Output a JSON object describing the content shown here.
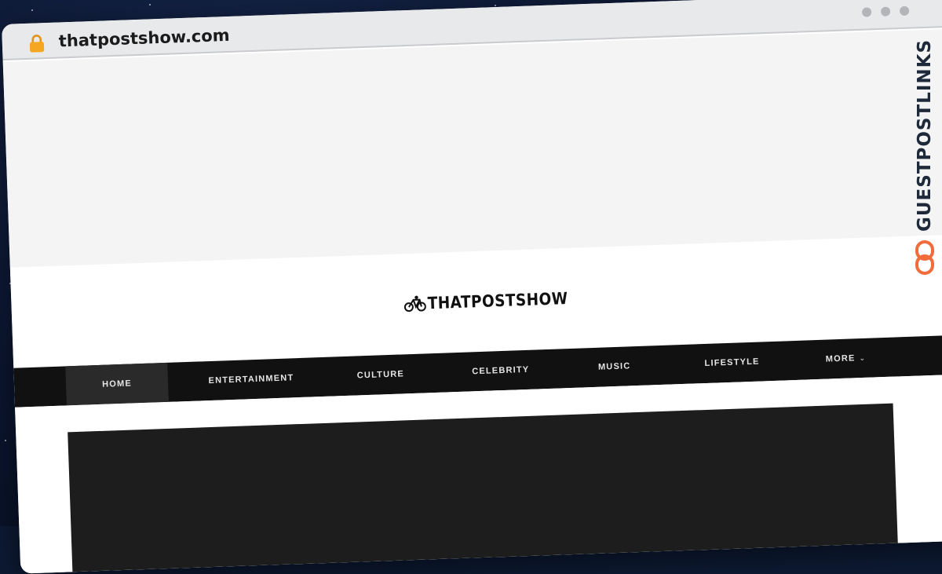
{
  "browser": {
    "url": "thatpostshow.com",
    "icons": {
      "lock": "lock-icon",
      "window_controls": [
        "dot-icon",
        "dot-icon",
        "dot-icon"
      ]
    }
  },
  "site": {
    "logo_text": "THATPOSTSHOW",
    "logo_icon": "bicycle-icon"
  },
  "nav": {
    "items": [
      {
        "label": "HOME",
        "active": true
      },
      {
        "label": "ENTERTAINMENT",
        "active": false
      },
      {
        "label": "CULTURE",
        "active": false
      },
      {
        "label": "CELEBRITY",
        "active": false
      },
      {
        "label": "MUSIC",
        "active": false
      },
      {
        "label": "LIFESTYLE",
        "active": false
      },
      {
        "label": "MORE",
        "active": false,
        "has_dropdown": true
      }
    ]
  },
  "watermark": {
    "text": "GUESTPOSTLINKS",
    "icon": "chain-link-icon",
    "accent_color": "#f26b3a",
    "text_color": "#1e2a3a"
  },
  "colors": {
    "nav_bg": "#111111",
    "nav_active_bg": "#2a2a2a",
    "ad_bg": "#f4f4f4",
    "hero_bg": "#1d1d1d",
    "lock": "#f5a623"
  }
}
